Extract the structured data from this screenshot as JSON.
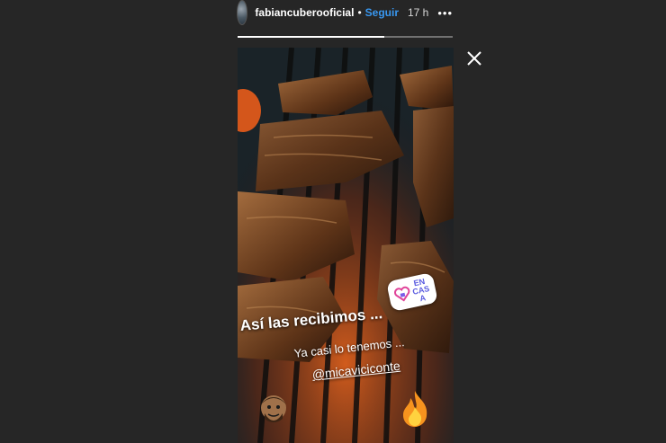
{
  "header": {
    "username": "fabiancuberooficial",
    "separator": "•",
    "follow_label": "Seguir",
    "time": "17 h",
    "more_label": "•••"
  },
  "progress": {
    "fraction": 0.68
  },
  "icons": {
    "close": "close-icon",
    "avatar": "avatar",
    "sticker": "en-casa-sticker",
    "face": "face-emoji",
    "fire": "fire-emoji"
  },
  "story": {
    "caption_line1": "Así las recibimos ...",
    "caption_line2": "Ya casi lo tenemos ...",
    "mention": "@micaviciconte",
    "sticker_text": "EN CASA"
  }
}
